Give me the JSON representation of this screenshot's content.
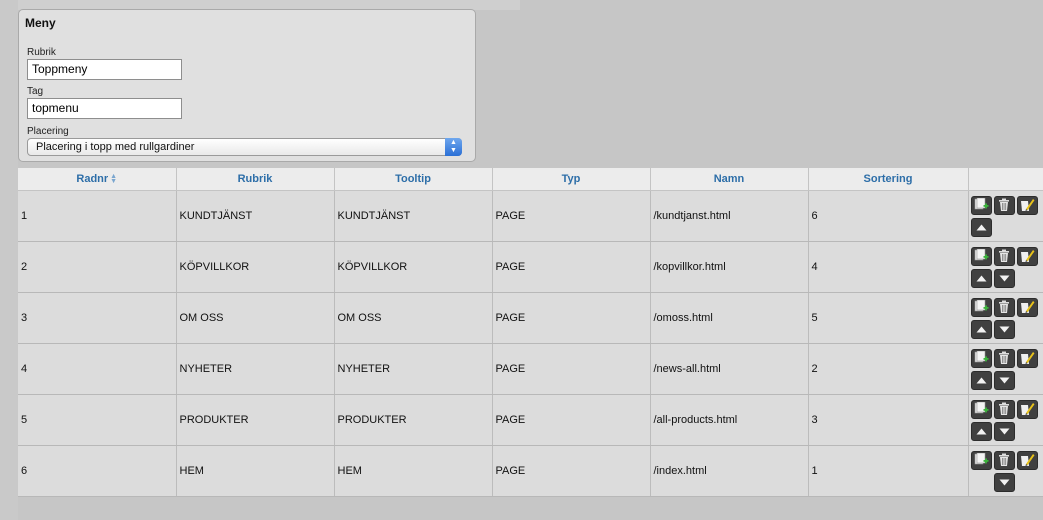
{
  "menu": {
    "title": "Meny",
    "rubrik_label": "Rubrik",
    "rubrik_value": "Toppmeny",
    "tag_label": "Tag",
    "tag_value": "topmenu",
    "placering_label": "Placering",
    "placering_value": "Placering i topp med rullgardiner"
  },
  "table": {
    "columns": [
      "Radnr",
      "Rubrik",
      "Tooltip",
      "Typ",
      "Namn",
      "Sortering"
    ],
    "rows": [
      [
        "1",
        "KUNDTJÄNST",
        "KUNDTJÄNST",
        "PAGE",
        "/kundtjanst.html",
        "6"
      ],
      [
        "2",
        "KÖPVILLKOR",
        "KÖPVILLKOR",
        "PAGE",
        "/kopvillkor.html",
        "4"
      ],
      [
        "3",
        "OM OSS",
        "OM OSS",
        "PAGE",
        "/omoss.html",
        "5"
      ],
      [
        "4",
        "NYHETER",
        "NYHETER",
        "PAGE",
        "/news-all.html",
        "2"
      ],
      [
        "5",
        "PRODUKTER",
        "PRODUKTER",
        "PAGE",
        "/all-products.html",
        "3"
      ],
      [
        "6",
        "HEM",
        "HEM",
        "PAGE",
        "/index.html",
        "1"
      ]
    ]
  },
  "icons": {
    "add": "add-page-icon",
    "delete": "trash-icon",
    "edit": "edit-pencil-icon",
    "up": "arrow-up-icon",
    "down": "arrow-down-icon"
  },
  "colors": {
    "header_text": "#2d6ea8",
    "button_bg": "#404040",
    "select_arrow": "#2a6fd6"
  }
}
